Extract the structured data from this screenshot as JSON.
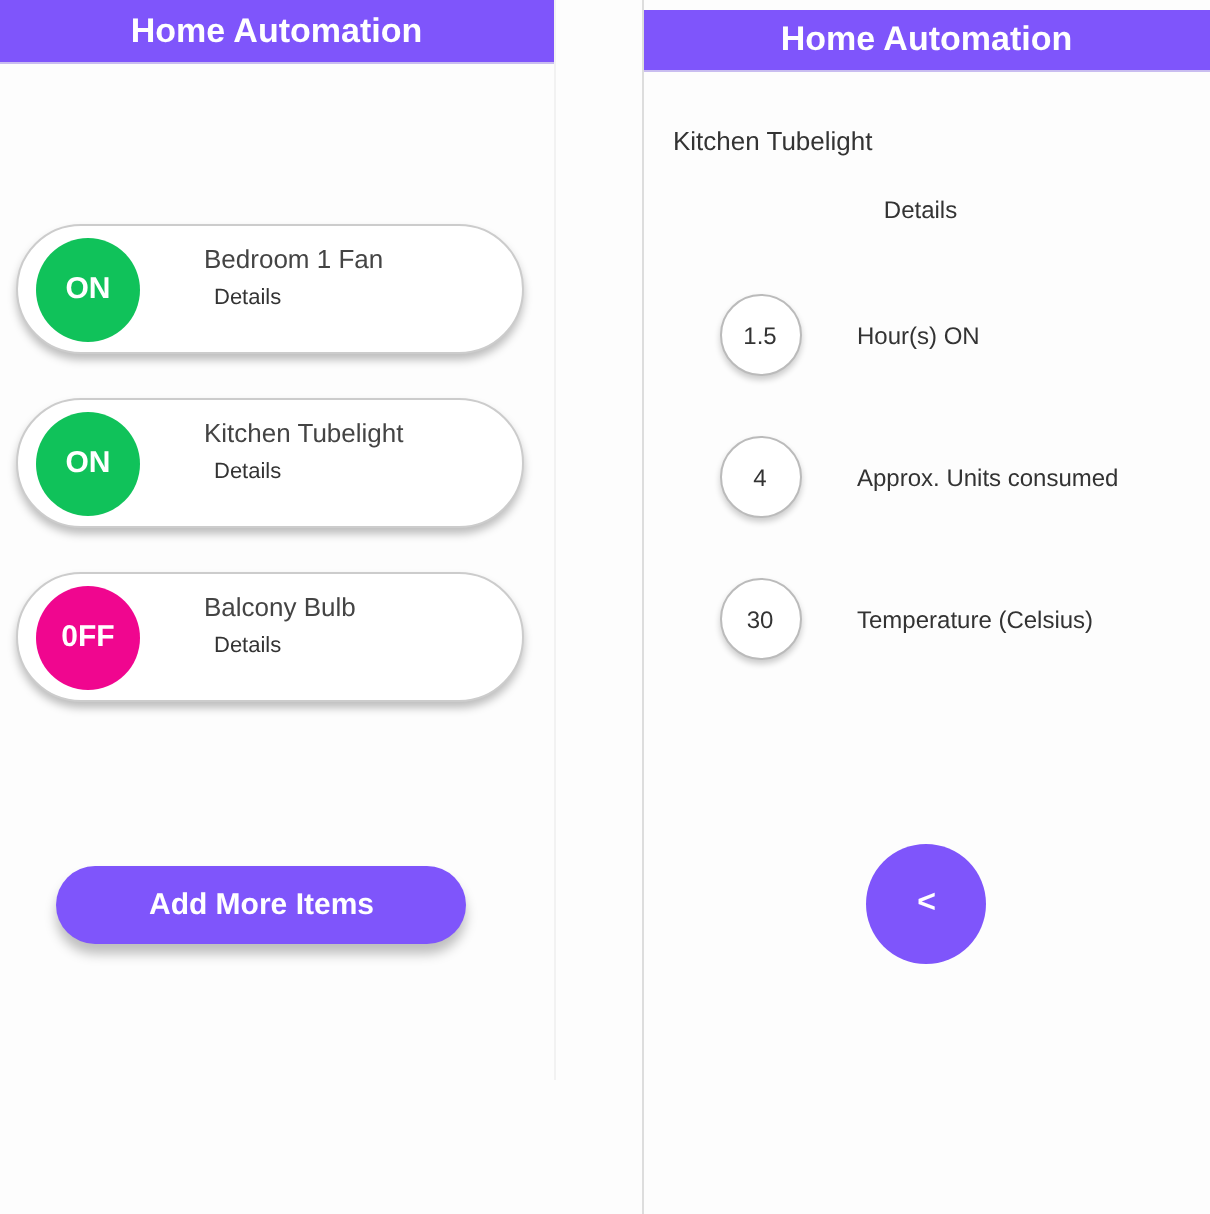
{
  "list_screen": {
    "title": "Home Automation",
    "devices": [
      {
        "name": "Bedroom 1 Fan",
        "state_label": "ON",
        "on": true,
        "details_label": "Details"
      },
      {
        "name": "Kitchen Tubelight",
        "state_label": "ON",
        "on": true,
        "details_label": "Details"
      },
      {
        "name": "Balcony Bulb",
        "state_label": "0FF",
        "on": false,
        "details_label": "Details"
      }
    ],
    "add_button": "Add More Items"
  },
  "detail_screen": {
    "title": "Home Automation",
    "device_name": "Kitchen Tubelight",
    "heading": "Details",
    "stats": [
      {
        "value": "1.5",
        "label": "Hour(s) ON"
      },
      {
        "value": "4",
        "label": "Approx. Units consumed"
      },
      {
        "value": "30",
        "label": "Temperature (Celsius)"
      }
    ],
    "back_button": "<"
  }
}
